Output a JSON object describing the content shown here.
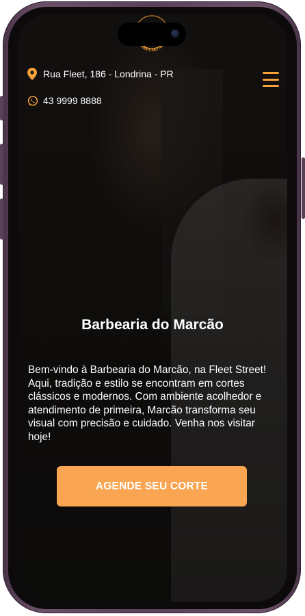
{
  "brand": {
    "logo_text": "BARBEARIA DO MARCÃO",
    "accent_color": "#f6a13a",
    "button_color": "#f9a552"
  },
  "header": {
    "address": "Rua Fleet, 186 - Londrina - PR",
    "address_icon": "map-pin-icon",
    "phone": "43 9999 8888",
    "phone_icon": "whatsapp-icon",
    "menu_icon": "hamburger-menu-icon"
  },
  "hero": {
    "title": "Barbearia do Marcão",
    "description": "Bem-vindo à Barbearia do Marcão, na Fleet Street! Aqui, tradição e estilo se encontram em cortes clássicos e modernos. Com ambiente acolhedor e atendimento de primeira, Marcão transforma seu visual com precisão e cuidado. Venha nos visitar hoje!",
    "cta_label": "AGENDE SEU CORTE"
  }
}
